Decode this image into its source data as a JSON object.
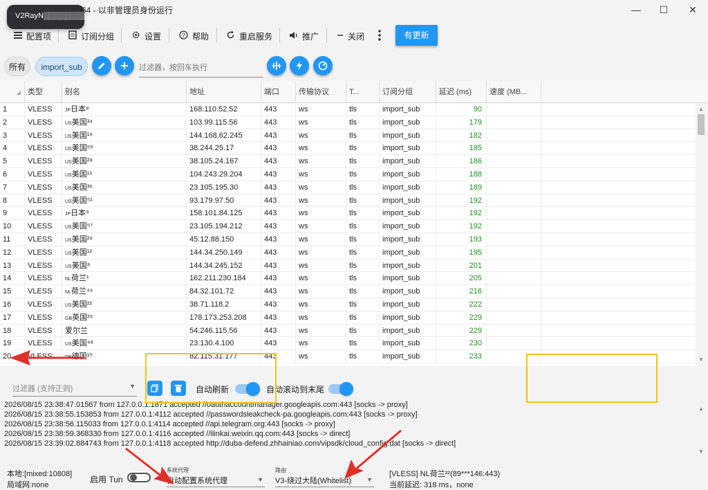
{
  "app": {
    "badge": "V2RayN▒▒▒▒▒▒▒▒▒",
    "title": "X64 - 以非管理员身份运行",
    "minimize_glyph": "—",
    "maximize_glyph": "☐",
    "close_glyph": "✕"
  },
  "toolbar": {
    "profiles": "配置项",
    "sub_group": "订阅分组",
    "settings": "设置",
    "help": "帮助",
    "restart": "重启服务",
    "promote": "推广",
    "close": "关闭",
    "update": "有更新"
  },
  "filter_row": {
    "chip_all": "所有",
    "chip_sub": "import_sub",
    "placeholder": "过滤器，按回车执行"
  },
  "table": {
    "headers": [
      "类型",
      "别名",
      "地址",
      "端口",
      "传输协议",
      "T...",
      "订阅分组",
      "延迟 (ms)",
      "速度 (MB..."
    ],
    "rows": [
      {
        "n": "1",
        "type": "VLESS",
        "flag": "JP",
        "alias": "日本⁸",
        "addr": "168.110.52.52",
        "port": "443",
        "net": "ws",
        "tls": "tls",
        "sub": "import_sub",
        "delay": "90"
      },
      {
        "n": "2",
        "type": "VLESS",
        "flag": "US",
        "alias": "美国³⁴",
        "addr": "103.99.115.56",
        "port": "443",
        "net": "ws",
        "tls": "tls",
        "sub": "import_sub",
        "delay": "179"
      },
      {
        "n": "3",
        "type": "VLESS",
        "flag": "US",
        "alias": "美国¹⁹",
        "addr": "144.168.62.245",
        "port": "443",
        "net": "ws",
        "tls": "tls",
        "sub": "import_sub",
        "delay": "182"
      },
      {
        "n": "4",
        "type": "VLESS",
        "flag": "US",
        "alias": "美国⁵⁹",
        "addr": "38.244.25.17",
        "port": "443",
        "net": "ws",
        "tls": "tls",
        "sub": "import_sub",
        "delay": "185"
      },
      {
        "n": "5",
        "type": "VLESS",
        "flag": "US",
        "alias": "美国²⁸",
        "addr": "38.105.24.167",
        "port": "443",
        "net": "ws",
        "tls": "tls",
        "sub": "import_sub",
        "delay": "186"
      },
      {
        "n": "6",
        "type": "VLESS",
        "flag": "US",
        "alias": "美国¹¹",
        "addr": "104.243.29.204",
        "port": "443",
        "net": "ws",
        "tls": "tls",
        "sub": "import_sub",
        "delay": "188"
      },
      {
        "n": "7",
        "type": "VLESS",
        "flag": "US",
        "alias": "美国³⁵",
        "addr": "23.105.195.30",
        "port": "443",
        "net": "ws",
        "tls": "tls",
        "sub": "import_sub",
        "delay": "189"
      },
      {
        "n": "8",
        "type": "VLESS",
        "flag": "US",
        "alias": "美国⁵¹",
        "addr": "93.179.97.50",
        "port": "443",
        "net": "ws",
        "tls": "tls",
        "sub": "import_sub",
        "delay": "192"
      },
      {
        "n": "9",
        "type": "VLESS",
        "flag": "JP",
        "alias": "日本⁹",
        "addr": "158.101.84.125",
        "port": "443",
        "net": "ws",
        "tls": "tls",
        "sub": "import_sub",
        "delay": "192"
      },
      {
        "n": "10",
        "type": "VLESS",
        "flag": "US",
        "alias": "美国⁵⁷",
        "addr": "23.105.194.212",
        "port": "443",
        "net": "ws",
        "tls": "tls",
        "sub": "import_sub",
        "delay": "192"
      },
      {
        "n": "11",
        "type": "VLESS",
        "flag": "US",
        "alias": "美国²⁹",
        "addr": "45.12.88.150",
        "port": "443",
        "net": "ws",
        "tls": "tls",
        "sub": "import_sub",
        "delay": "193"
      },
      {
        "n": "12",
        "type": "VLESS",
        "flag": "US",
        "alias": "美国¹²",
        "addr": "144.34.250.149",
        "port": "443",
        "net": "ws",
        "tls": "tls",
        "sub": "import_sub",
        "delay": "195"
      },
      {
        "n": "13",
        "type": "VLESS",
        "flag": "US",
        "alias": "美国⁸",
        "addr": "144.34.245.152",
        "port": "443",
        "net": "ws",
        "tls": "tls",
        "sub": "import_sub",
        "delay": "201"
      },
      {
        "n": "14",
        "type": "VLESS",
        "flag": "NL",
        "alias": "荷兰¹",
        "addr": "162.211.230.184",
        "port": "443",
        "net": "ws",
        "tls": "tls",
        "sub": "import_sub",
        "delay": "205"
      },
      {
        "n": "15",
        "type": "VLESS",
        "flag": "NL",
        "alias": "荷兰⁴⁴",
        "addr": "84.32.101.72",
        "port": "443",
        "net": "ws",
        "tls": "tls",
        "sub": "import_sub",
        "delay": "216"
      },
      {
        "n": "16",
        "type": "VLESS",
        "flag": "US",
        "alias": "美国²²",
        "addr": "38.71.118.2",
        "port": "443",
        "net": "ws",
        "tls": "tls",
        "sub": "import_sub",
        "delay": "222"
      },
      {
        "n": "17",
        "type": "VLESS",
        "flag": "GB",
        "alias": "英国²⁹",
        "addr": "178.173.253.208",
        "port": "443",
        "net": "ws",
        "tls": "tls",
        "sub": "import_sub",
        "delay": "229"
      },
      {
        "n": "18",
        "type": "VLESS",
        "flag": "",
        "alias": "爱尔兰",
        "addr": "54.246.115.56",
        "port": "443",
        "net": "ws",
        "tls": "tls",
        "sub": "import_sub",
        "delay": "229"
      },
      {
        "n": "19",
        "type": "VLESS",
        "flag": "US",
        "alias": "美国⁴⁸",
        "addr": "23.130.4.100",
        "port": "443",
        "net": "ws",
        "tls": "tls",
        "sub": "import_sub",
        "delay": "230"
      },
      {
        "n": "20",
        "type": "VLESS",
        "flag": "DE",
        "alias": "德国¹⁰",
        "addr": "82.115.31.177",
        "port": "443",
        "net": "ws",
        "tls": "tls",
        "sub": "import_sub",
        "delay": "233"
      }
    ]
  },
  "log": {
    "filter_placeholder": "过滤器 (支持正则)",
    "auto_refresh": "自动刷新",
    "auto_scroll": "自动滚动到末尾",
    "lines": [
      "2026/08/15 23:38:47.01567 from 127.0.0.1:1871 accepted //oauthaccountmanager.googleapis.com:443 [socks -> proxy]",
      "2026/08/15 23:38:55.153853 from 127.0.0.1:4112 accepted //passwordsleakcheck-pa.googleapis.com:443 [socks -> proxy]",
      "2026/08/15 23:38:56.115033 from 127.0.0.1:4114 accepted //api.telegram.org:443 [socks -> proxy]",
      "2026/08/15 23:38:59.368330 from 127.0.0.1:4116 accepted //ilinkai.weixin.qq.com:443 [socks -> direct]",
      "2026/08/15 23:39:02.884743 from 127.0.0.1:4118 accepted http://duba-defend.zhhainiao.com/vipsdk/cloud_config.dat [socks -> direct]"
    ]
  },
  "status": {
    "local": "本地:[mixed:10808]",
    "lan": "局域网:none",
    "tun_label": "启用 Tun",
    "sysproxy_small": "系统代理",
    "sysproxy_value": "自动配置系统代理",
    "routing_small": "路由",
    "routing_value": "V3-绕过大陆(Whitelist)",
    "server": "[VLESS] NL荷兰²²(89***146:443)",
    "delay": "当前延迟: 318 ms，none"
  },
  "colors": {
    "accent": "#2196f3",
    "delay_green": "#1e8f1e",
    "annotation_yellow": "#f4c20d",
    "annotation_red": "#e0302a"
  }
}
